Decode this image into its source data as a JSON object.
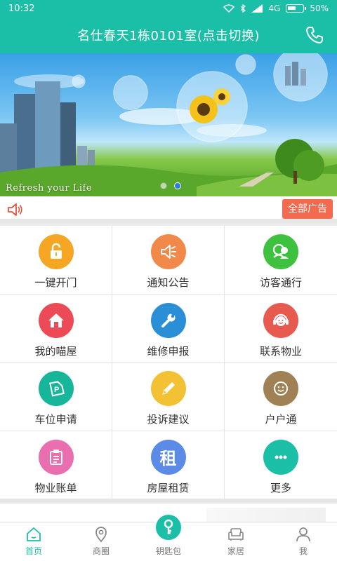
{
  "status_bar": {
    "time": "10:32",
    "network": "4G",
    "battery": "50%"
  },
  "header": {
    "title": "名仕春天1栋0101室(点击切换)"
  },
  "banner": {
    "caption": "Refresh your Life",
    "dots_count": 2,
    "active_dot": 2
  },
  "notice": {
    "all_ads_label": "全部广告"
  },
  "grid": [
    {
      "label": "一键开门",
      "icon": "unlock-icon",
      "color": "#f5a623"
    },
    {
      "label": "通知公告",
      "icon": "megaphone-icon",
      "color": "#f0894a"
    },
    {
      "label": "访客通行",
      "icon": "visitor-icon",
      "color": "#3ec13e"
    },
    {
      "label": "我的喵屋",
      "icon": "house-icon",
      "color": "#ec4a56"
    },
    {
      "label": "维修申报",
      "icon": "wrench-icon",
      "color": "#2b8fd8"
    },
    {
      "label": "联系物业",
      "icon": "headset-icon",
      "color": "#e75a4f"
    },
    {
      "label": "车位申请",
      "icon": "parking-tag-icon",
      "color": "#17b59a"
    },
    {
      "label": "投诉建议",
      "icon": "pencil-icon",
      "color": "#f2c234"
    },
    {
      "label": "户户通",
      "icon": "smile-chat-icon",
      "color": "#a08156"
    },
    {
      "label": "物业账单",
      "icon": "bill-icon",
      "color": "#ea6fb0"
    },
    {
      "label": "房屋租赁",
      "icon": "rent-char-icon",
      "color": "#5b8be6",
      "glyph": "租"
    },
    {
      "label": "更多",
      "icon": "more-dots-icon",
      "color": "#1bbfa8"
    }
  ],
  "tabs": [
    {
      "label": "首页",
      "icon": "home-icon",
      "active": true
    },
    {
      "label": "商圈",
      "icon": "location-icon",
      "active": false
    },
    {
      "label": "钥匙包",
      "icon": "key-icon",
      "active": false
    },
    {
      "label": "家居",
      "icon": "sofa-icon",
      "active": false
    },
    {
      "label": "我",
      "icon": "person-icon",
      "active": false
    }
  ]
}
